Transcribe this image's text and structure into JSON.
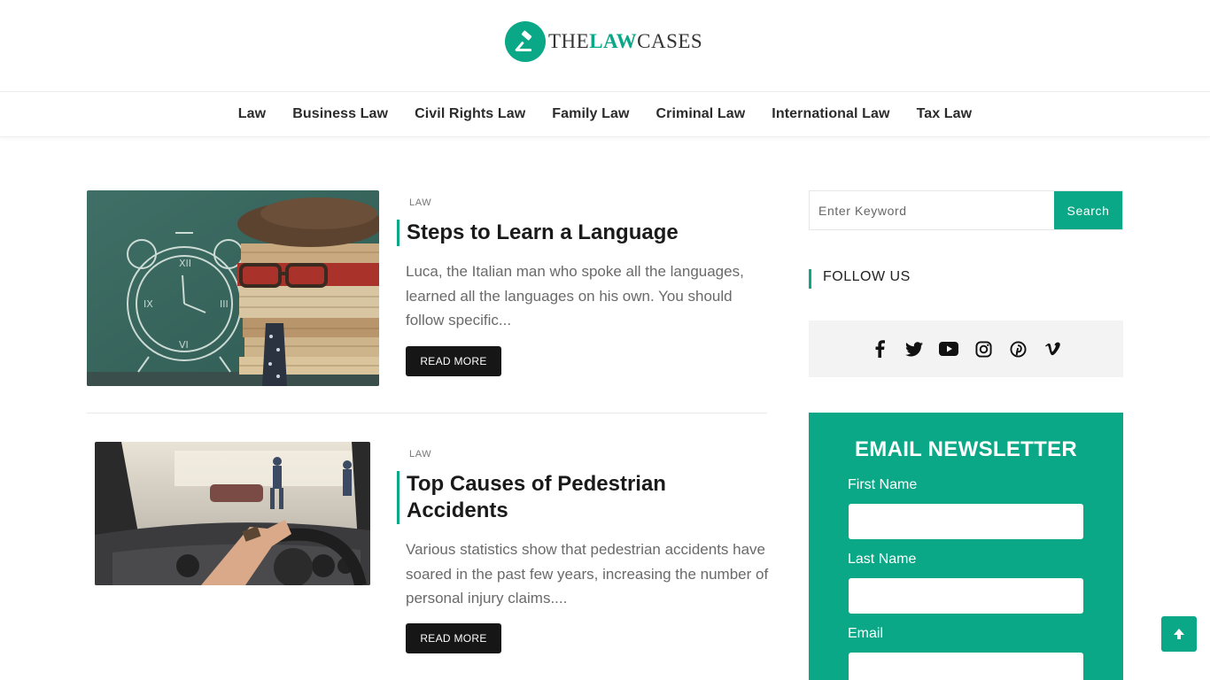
{
  "brand": {
    "logo_left": "THE",
    "logo_mid": "LAW",
    "logo_right": "CASES",
    "accent_color": "#0aa886"
  },
  "nav": {
    "items": [
      {
        "label": "Law"
      },
      {
        "label": "Business Law"
      },
      {
        "label": "Civil Rights Law"
      },
      {
        "label": "Family Law"
      },
      {
        "label": "Criminal Law"
      },
      {
        "label": "International Law"
      },
      {
        "label": "Tax Law"
      }
    ]
  },
  "posts": [
    {
      "category": "LAW",
      "title": "Steps to Learn a Language",
      "excerpt": "Luca, the Italian man who spoke all the languages, learned all the languages on his own. You should follow specific...",
      "read_more": "READ MORE",
      "image": "chalkboard-clock-books-photo"
    },
    {
      "category": "LAW",
      "title": "Top Causes of Pedestrian Accidents",
      "excerpt": "Various statistics show that pedestrian accidents have soared in the past few years, increasing the number of personal injury claims....",
      "read_more": "READ MORE",
      "image": "driver-steering-wheel-photo"
    }
  ],
  "sidebar": {
    "search": {
      "placeholder": "Enter Keyword",
      "button": "Search"
    },
    "follow": {
      "heading": "FOLLOW US",
      "icons": [
        "facebook-icon",
        "twitter-icon",
        "youtube-icon",
        "instagram-icon",
        "pinterest-icon",
        "vimeo-icon"
      ]
    },
    "newsletter": {
      "title": "EMAIL NEWSLETTER",
      "first_name_label": "First Name",
      "last_name_label": "Last Name",
      "email_label": "Email"
    }
  },
  "back_to_top_icon": "arrow-up-icon"
}
